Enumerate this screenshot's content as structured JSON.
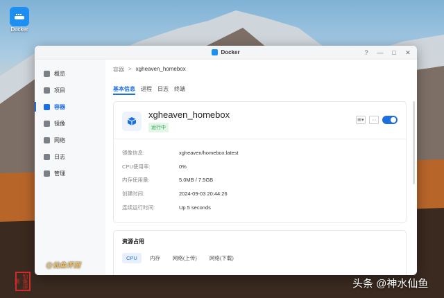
{
  "desktop": {
    "icon_label": "Docker"
  },
  "window": {
    "title": "Docker",
    "controls": {
      "help": "?",
      "minimize": "—",
      "maximize": "□",
      "close": "✕"
    }
  },
  "sidebar": {
    "items": [
      {
        "label": "概览",
        "icon": "overview-icon"
      },
      {
        "label": "项目",
        "icon": "project-icon"
      },
      {
        "label": "容器",
        "icon": "container-icon",
        "active": true
      },
      {
        "label": "镜像",
        "icon": "image-icon"
      },
      {
        "label": "网络",
        "icon": "network-icon"
      },
      {
        "label": "日志",
        "icon": "log-icon"
      },
      {
        "label": "管理",
        "icon": "manage-icon"
      }
    ]
  },
  "breadcrumb": {
    "root": "容器",
    "sep": ">",
    "current": "xgheaven_homebox"
  },
  "tabs": [
    "基本信息",
    "进程",
    "日志",
    "终端"
  ],
  "container": {
    "name": "xgheaven_homebox",
    "status": "运行中",
    "info": [
      {
        "key": "镜像信息:",
        "value": "xgheaven/homebox:latest"
      },
      {
        "key": "CPU使用率:",
        "value": "0%"
      },
      {
        "key": "内存使用量:",
        "value": "5.0MB / 7.5GB"
      },
      {
        "key": "创建时间:",
        "value": "2024-09-03 20:44:26"
      },
      {
        "key": "连续运行时间:",
        "value": "Up 5 seconds"
      }
    ]
  },
  "resources": {
    "title": "资源占用",
    "tabs": [
      "CPU",
      "内存",
      "网络(上传)",
      "网络(下载)"
    ]
  },
  "watermarks": {
    "left": "@仙鱼评测",
    "seal": "仙鱼评测",
    "right": "头条 @神水仙鱼"
  },
  "colors": {
    "accent": "#1d6fe0",
    "running": "#2aa34a"
  }
}
